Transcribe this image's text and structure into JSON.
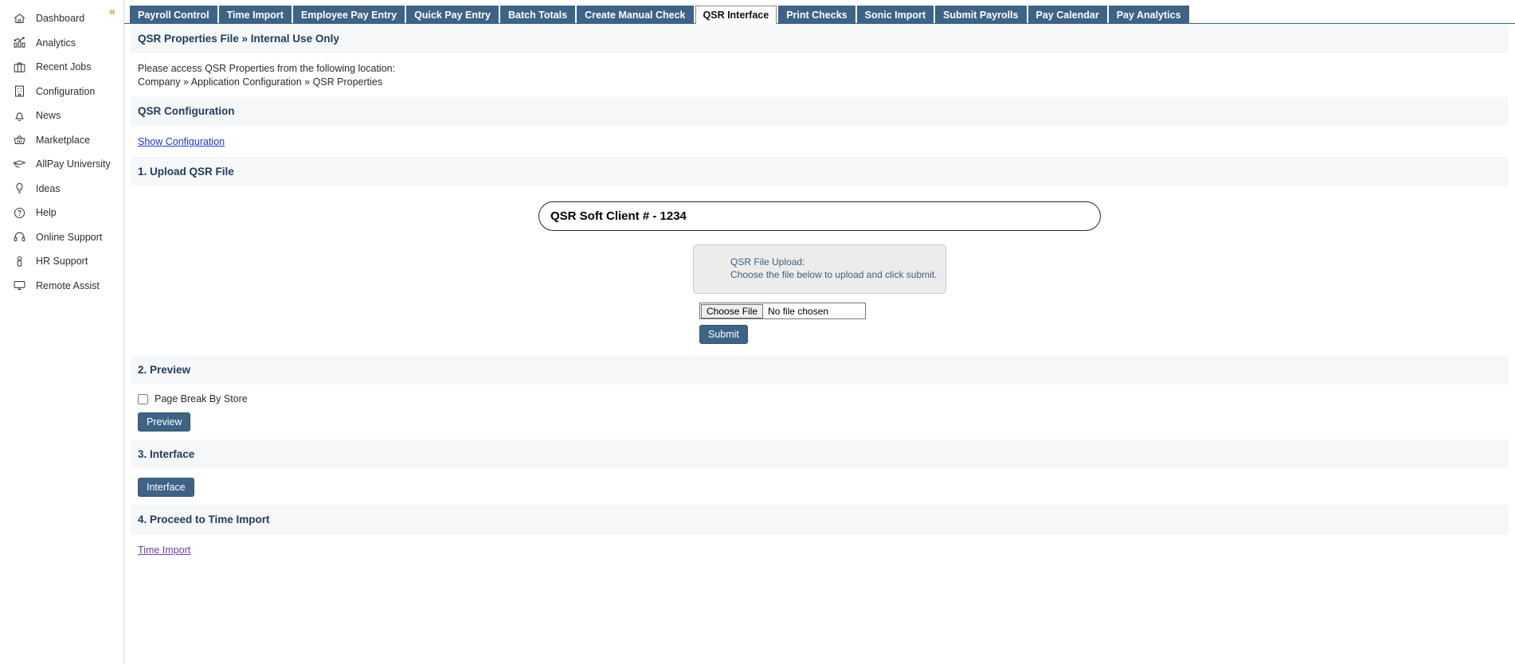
{
  "sidebar": {
    "collapse_icon": "«",
    "items": [
      {
        "label": "Dashboard",
        "icon": "home-icon"
      },
      {
        "label": "Analytics",
        "icon": "analytics-chart-icon"
      },
      {
        "label": "Recent Jobs",
        "icon": "briefcase-icon"
      },
      {
        "label": "Configuration",
        "icon": "building-icon"
      },
      {
        "label": "News",
        "icon": "bell-icon"
      },
      {
        "label": "Marketplace",
        "icon": "basket-icon"
      },
      {
        "label": "AllPay University",
        "icon": "graduation-cap-icon"
      },
      {
        "label": "Ideas",
        "icon": "lightbulb-icon"
      },
      {
        "label": "Help",
        "icon": "question-circle-icon"
      },
      {
        "label": "Online Support",
        "icon": "headset-icon"
      },
      {
        "label": "HR Support",
        "icon": "person-icon"
      },
      {
        "label": "Remote Assist",
        "icon": "monitor-icon"
      }
    ]
  },
  "tabs": [
    {
      "label": "Payroll Control",
      "active": false
    },
    {
      "label": "Time Import",
      "active": false
    },
    {
      "label": "Employee Pay Entry",
      "active": false
    },
    {
      "label": "Quick Pay Entry",
      "active": false
    },
    {
      "label": "Batch Totals",
      "active": false
    },
    {
      "label": "Create Manual Check",
      "active": false
    },
    {
      "label": "QSR Interface",
      "active": true
    },
    {
      "label": "Print Checks",
      "active": false
    },
    {
      "label": "Sonic Import",
      "active": false
    },
    {
      "label": "Submit Payrolls",
      "active": false
    },
    {
      "label": "Pay Calendar",
      "active": false
    },
    {
      "label": "Pay Analytics",
      "active": false
    }
  ],
  "page": {
    "title": "QSR Properties File » Internal Use Only",
    "info_line_1": "Please access QSR Properties from the following location:",
    "info_line_2": "Company » Application Configuration » QSR Properties",
    "config_heading": "QSR Configuration",
    "show_configuration_link": "Show Configuration",
    "step1_heading": "1. Upload QSR File",
    "client_label": "QSR Soft Client # - 1234",
    "upload_title": "QSR File Upload:",
    "upload_subtitle": "Choose the file below to upload and click submit.",
    "choose_file_button": "Choose File",
    "file_chosen_text": "No file chosen",
    "submit_button": "Submit",
    "step2_heading": "2. Preview",
    "page_break_label": "Page Break By Store",
    "page_break_checked": false,
    "preview_button": "Preview",
    "step3_heading": "3. Interface",
    "interface_button": "Interface",
    "step4_heading": "4. Proceed to Time Import",
    "time_import_link": "Time Import"
  },
  "colors": {
    "tab_blue": "#3d6387",
    "heading_navy": "#1f3b5c",
    "link_blue": "#1c36d8",
    "link_visited": "#6a3fb5",
    "accent_orange": "#f08b2a",
    "section_bg": "#f6f7f9"
  }
}
